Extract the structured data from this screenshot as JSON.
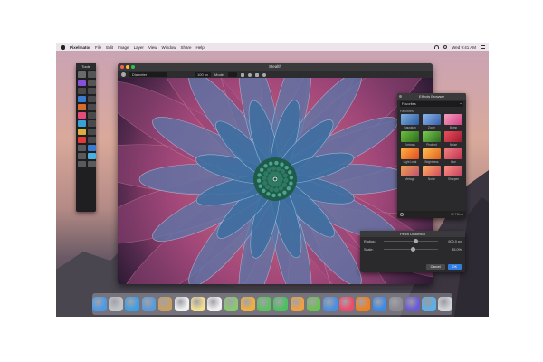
{
  "menubar": {
    "app": "Pixelmator",
    "items": [
      "File",
      "Edit",
      "Image",
      "Layer",
      "View",
      "Window",
      "Share",
      "Help"
    ],
    "clock": "Wed 9:41 AM"
  },
  "tools": {
    "title": "Tools",
    "items": [
      {
        "name": "move-tool",
        "color": "#6a6a6c"
      },
      {
        "name": "select-tool",
        "color": "#555"
      },
      {
        "name": "brush-tool",
        "color": "#8a4fd8"
      },
      {
        "name": "lasso-tool",
        "color": "#555"
      },
      {
        "name": "crop-tool",
        "color": "#4a4a4c"
      },
      {
        "name": "slice-tool",
        "color": "#4a4a4c"
      },
      {
        "name": "type-tool",
        "color": "#3a7ad0"
      },
      {
        "name": "eyedropper-tool",
        "color": "#4a4a4c"
      },
      {
        "name": "paint-bucket-tool",
        "color": "#d86a2a"
      },
      {
        "name": "gradient-tool",
        "color": "#4a4a4c"
      },
      {
        "name": "eraser-tool",
        "color": "#e44c7a"
      },
      {
        "name": "clone-tool",
        "color": "#4a4a4c"
      },
      {
        "name": "blur-tool",
        "color": "#3aa0d8"
      },
      {
        "name": "sharpen-tool",
        "color": "#4a4a4c"
      },
      {
        "name": "sponge-tool",
        "color": "#d8b03a"
      },
      {
        "name": "dodge-tool",
        "color": "#4a4a4c"
      },
      {
        "name": "red-eye-tool",
        "color": "#e03a3a"
      },
      {
        "name": "repair-tool",
        "color": "#4a4a4c"
      },
      {
        "name": "pen-tool",
        "color": "#5a5a5c"
      },
      {
        "name": "shape-tool",
        "color": "#3a7ad0"
      },
      {
        "name": "fill-tool",
        "color": "#5a5a5c"
      },
      {
        "name": "color-tool",
        "color": "#4ab0e0"
      },
      {
        "name": "zoom-tool",
        "color": "#5a5a5c"
      },
      {
        "name": "hand-tool",
        "color": "#5a5a5c"
      }
    ]
  },
  "window": {
    "title": "Stealth",
    "options": {
      "tool_label": "Diameter",
      "size_value": "100 px",
      "mode_label": "Mode:"
    }
  },
  "effects": {
    "title": "Effects Browser",
    "category": "Favorites",
    "section": "Favorites",
    "thumbs": [
      {
        "label": "Gaussian",
        "color1": "#7fb0e0",
        "color2": "#2e5aa0"
      },
      {
        "label": "Zoom",
        "color1": "#8ab8ee",
        "color2": "#3a5fa8"
      },
      {
        "label": "Bump",
        "color1": "#f4a0c0",
        "color2": "#d04080"
      },
      {
        "label": "Emboss",
        "color1": "#6ac040",
        "color2": "#2e6a1a"
      },
      {
        "label": "Pinched",
        "color1": "#7acc50",
        "color2": "#2e6a20"
      },
      {
        "label": "Noise",
        "color1": "#e8505a",
        "color2": "#a01830"
      },
      {
        "label": "Light Leak",
        "color1": "#ffb040",
        "color2": "#e04a20"
      },
      {
        "label": "Brightness",
        "color1": "#ffc050",
        "color2": "#e06020"
      },
      {
        "label": "Hue",
        "color1": "#f08080",
        "color2": "#c03050"
      },
      {
        "label": "Vintage",
        "color1": "#f0a050",
        "color2": "#c05070"
      },
      {
        "label": "Noise",
        "color1": "#ffb060",
        "color2": "#d04a60"
      },
      {
        "label": "Sharpen",
        "color1": "#ff9080",
        "color2": "#c04060"
      }
    ],
    "footer_count": "10 Filters"
  },
  "pinch": {
    "title": "Pinch Distortion",
    "radius_label": "Radius:",
    "radius_value": "600.0 px",
    "radius_level": 0.55,
    "scale_label": "Scale:",
    "scale_value": "85.0%",
    "scale_level": 0.5,
    "cancel_label": "Cancel",
    "ok_label": "OK"
  },
  "dock": {
    "icons": [
      {
        "name": "finder-icon",
        "color": "#4a9ae8"
      },
      {
        "name": "launchpad-icon",
        "color": "#c0c4c8"
      },
      {
        "name": "safari-icon",
        "color": "#3aa0e8"
      },
      {
        "name": "mail-icon",
        "color": "#5a9ad8"
      },
      {
        "name": "contacts-icon",
        "color": "#c8a060"
      },
      {
        "name": "calendar-icon",
        "color": "#f0f0f0"
      },
      {
        "name": "notes-icon",
        "color": "#f4e090"
      },
      {
        "name": "reminders-icon",
        "color": "#f0f0f0"
      },
      {
        "name": "maps-icon",
        "color": "#8ac870"
      },
      {
        "name": "photos-icon",
        "color": "#f0b040"
      },
      {
        "name": "messages-icon",
        "color": "#5ac060"
      },
      {
        "name": "facetime-icon",
        "color": "#4ac060"
      },
      {
        "name": "pages-icon",
        "color": "#f0a040"
      },
      {
        "name": "numbers-icon",
        "color": "#6ac050"
      },
      {
        "name": "keynote-icon",
        "color": "#4a90e0"
      },
      {
        "name": "itunes-icon",
        "color": "#f04a6a"
      },
      {
        "name": "ibooks-icon",
        "color": "#f08020"
      },
      {
        "name": "app-store-icon",
        "color": "#3a8ae8"
      },
      {
        "name": "system-preferences-icon",
        "color": "#8a8a90"
      },
      {
        "name": "pixelmator-icon",
        "color": "#6a5ad8"
      },
      {
        "name": "folder-icon",
        "color": "#5ab0e8"
      },
      {
        "name": "trash-icon",
        "color": "#d0d4d8"
      }
    ]
  }
}
